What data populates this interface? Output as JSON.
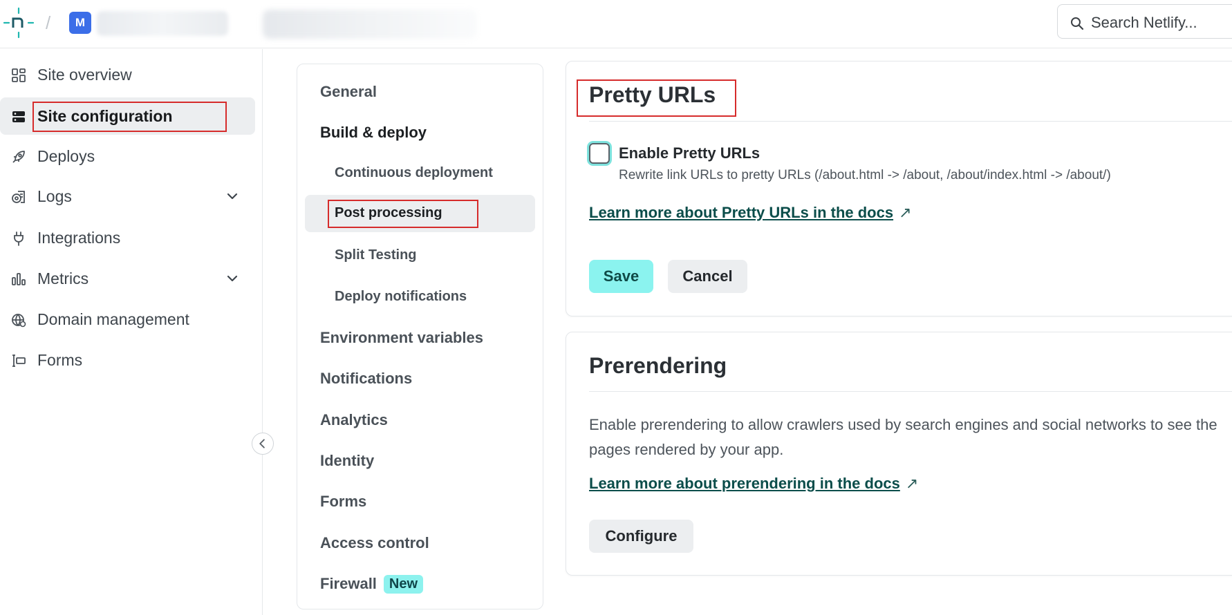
{
  "topbar": {
    "breadcrumb_separator": "/",
    "site_avatar_letter": "M",
    "search_placeholder": "Search Netlify..."
  },
  "sidebar": {
    "items": [
      {
        "label": "Site overview",
        "icon": "grid-icon"
      },
      {
        "label": "Site configuration",
        "icon": "server-icon",
        "active": true
      },
      {
        "label": "Deploys",
        "icon": "rocket-icon"
      },
      {
        "label": "Logs",
        "icon": "logs-icon",
        "expandable": true
      },
      {
        "label": "Integrations",
        "icon": "plug-icon"
      },
      {
        "label": "Metrics",
        "icon": "bar-chart-icon",
        "expandable": true
      },
      {
        "label": "Domain management",
        "icon": "globe-icon"
      },
      {
        "label": "Forms",
        "icon": "form-icon"
      }
    ]
  },
  "subnav": {
    "items": [
      {
        "label": "General"
      },
      {
        "label": "Build & deploy"
      },
      {
        "label": "Continuous deployment"
      },
      {
        "label": "Post processing",
        "active": true
      },
      {
        "label": "Split Testing"
      },
      {
        "label": "Deploy notifications"
      },
      {
        "label": "Environment variables"
      },
      {
        "label": "Notifications"
      },
      {
        "label": "Analytics"
      },
      {
        "label": "Identity"
      },
      {
        "label": "Forms"
      },
      {
        "label": "Access control"
      },
      {
        "label": "Firewall",
        "badge": "New"
      }
    ]
  },
  "pretty_urls": {
    "title": "Pretty URLs",
    "checkbox_label": "Enable Pretty URLs",
    "checkbox_checked": false,
    "description": "Rewrite link URLs to pretty URLs (/about.html -> /about, /about/index.html -> /about/)",
    "docs_link": "Learn more about Pretty URLs in the docs",
    "save_label": "Save",
    "cancel_label": "Cancel"
  },
  "prerendering": {
    "title": "Prerendering",
    "description": "Enable prerendering to allow crawlers used by search engines and social networks to see the pages rendered by your app.",
    "docs_link": "Learn more about prerendering in the docs",
    "configure_label": "Configure"
  },
  "colors": {
    "accent": "#8bf3ef",
    "link": "#0b4d4a",
    "avatar": "#3b6ee8",
    "annotation": "#d62b2b"
  }
}
